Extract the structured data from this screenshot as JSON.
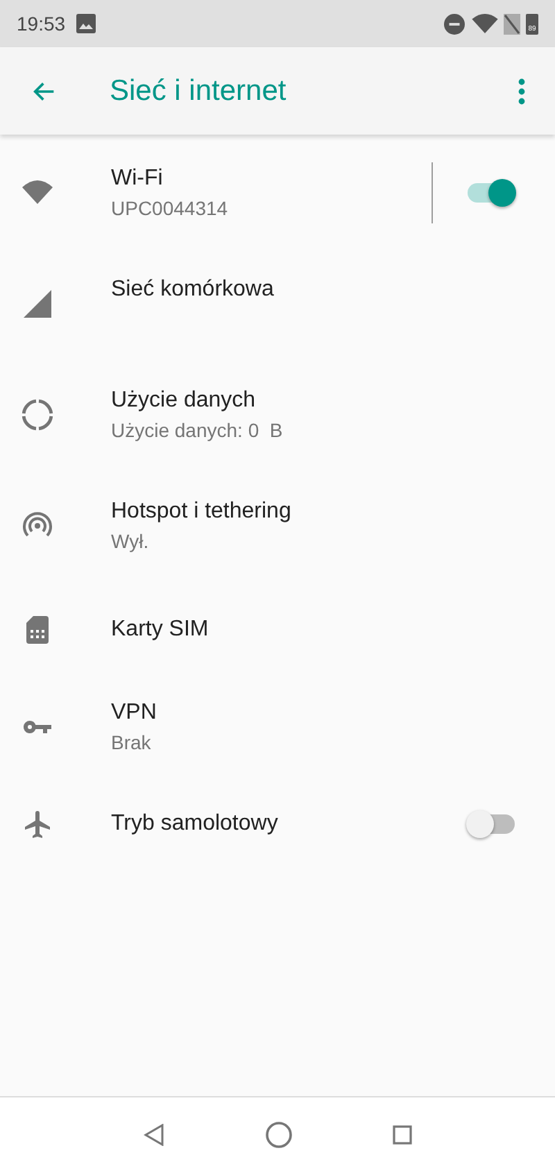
{
  "status_bar": {
    "time": "19:53",
    "battery": "89"
  },
  "app_bar": {
    "title": "Sieć i internet"
  },
  "items": [
    {
      "title": "Wi-Fi",
      "summary": "UPC0044314",
      "kind": "switch",
      "on": true
    },
    {
      "title": "Sieć komórkowa",
      "kind": "link"
    },
    {
      "title": "Użycie danych",
      "summary": "Użycie danych: 0  B",
      "kind": "link"
    },
    {
      "title": "Hotspot i tethering",
      "summary": "Wył.",
      "kind": "link"
    },
    {
      "title": "Karty SIM",
      "kind": "link"
    },
    {
      "title": "VPN",
      "summary": "Brak",
      "kind": "link"
    },
    {
      "title": "Tryb samolotowy",
      "kind": "switch",
      "on": false
    }
  ]
}
